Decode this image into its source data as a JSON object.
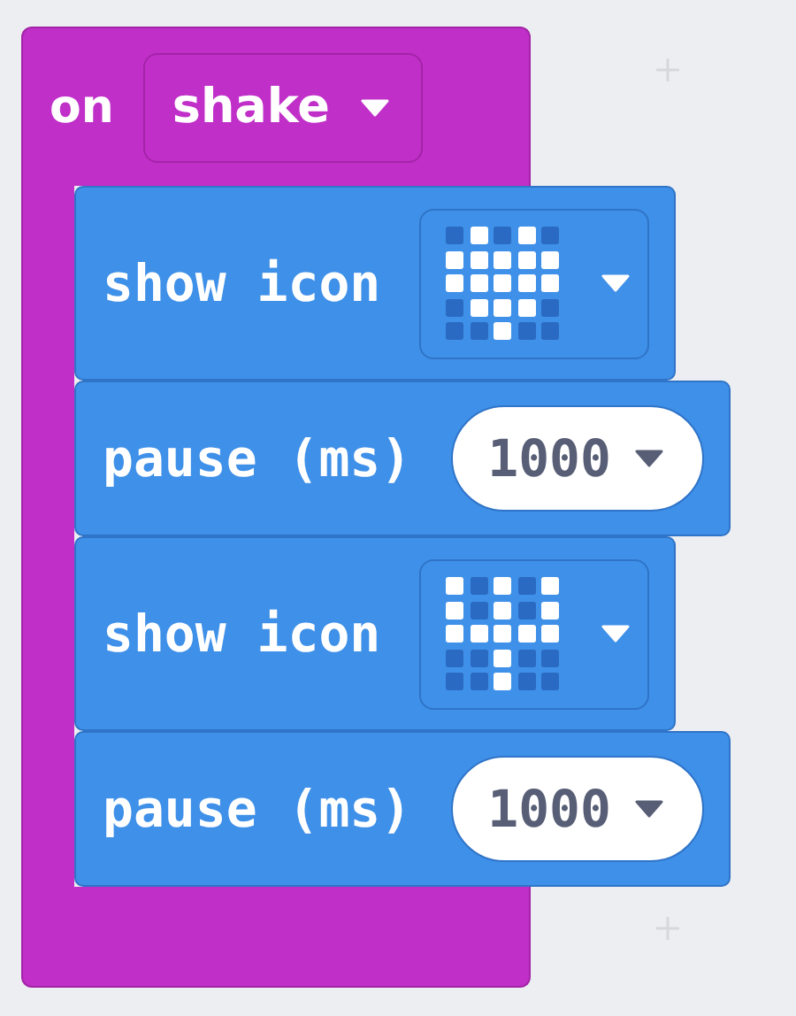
{
  "event": {
    "label": "on",
    "trigger": "shake"
  },
  "blocks": [
    {
      "kind": "show_icon",
      "label": "show icon",
      "leds": [
        [
          false,
          true,
          false,
          true,
          false
        ],
        [
          true,
          true,
          true,
          true,
          true
        ],
        [
          true,
          true,
          true,
          true,
          true
        ],
        [
          false,
          true,
          true,
          true,
          false
        ],
        [
          false,
          false,
          true,
          false,
          false
        ]
      ]
    },
    {
      "kind": "pause",
      "label": "pause (ms)",
      "value": "1000"
    },
    {
      "kind": "show_icon",
      "label": "show icon",
      "leds": [
        [
          true,
          false,
          true,
          false,
          true
        ],
        [
          true,
          false,
          true,
          false,
          true
        ],
        [
          true,
          true,
          true,
          true,
          true
        ],
        [
          false,
          false,
          true,
          false,
          false
        ],
        [
          false,
          false,
          true,
          false,
          false
        ]
      ]
    },
    {
      "kind": "pause",
      "label": "pause (ms)",
      "value": "1000"
    }
  ]
}
